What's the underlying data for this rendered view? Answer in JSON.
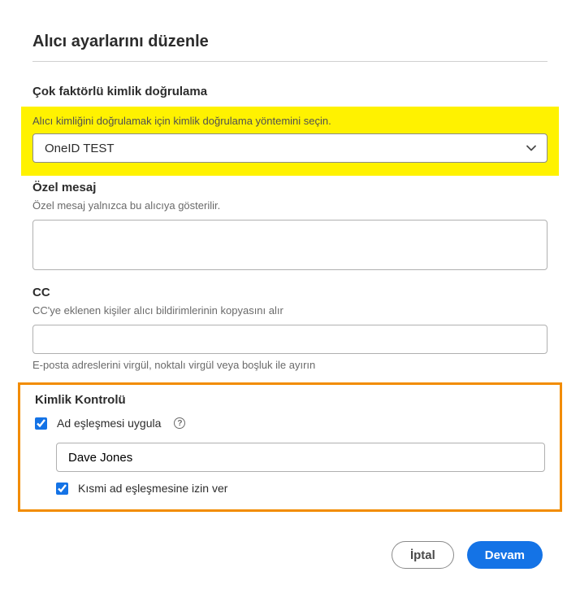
{
  "dialog": {
    "title": "Alıcı ayarlarını düzenle"
  },
  "mfa": {
    "heading": "Çok faktörlü kimlik doğrulama",
    "hint": "Alıcı kimliğini doğrulamak için kimlik doğrulama yöntemini seçin.",
    "selected": "OneID TEST"
  },
  "privateMessage": {
    "label": "Özel mesaj",
    "hint": "Özel mesaj yalnızca bu alıcıya gösterilir.",
    "value": ""
  },
  "cc": {
    "label": "CC",
    "hint": "CC'ye eklenen kişiler alıcı bildirimlerinin kopyasını alır",
    "value": "",
    "helper": "E-posta adreslerini virgül, noktalı virgül veya boşluk ile ayırın"
  },
  "identity": {
    "heading": "Kimlik Kontrolü",
    "applyNameMatch": {
      "label": "Ad eşleşmesi uygula",
      "checked": true
    },
    "nameValue": "Dave Jones",
    "allowPartial": {
      "label": "Kısmi ad eşleşmesine izin ver",
      "checked": true
    }
  },
  "actions": {
    "cancel": "İptal",
    "continue": "Devam"
  }
}
